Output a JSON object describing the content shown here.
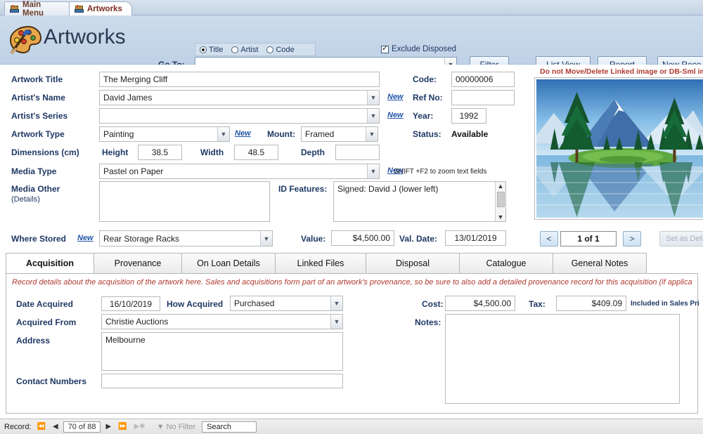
{
  "window": {
    "doc_tabs": [
      {
        "label": "Main Menu",
        "icon": "database-form-icon",
        "active": false
      },
      {
        "label": "Artworks",
        "icon": "database-form-icon",
        "active": true
      }
    ]
  },
  "header": {
    "title": "Artworks",
    "logo_icon": "artist-palette-icon",
    "search_modes": [
      {
        "label": "Title",
        "selected": true
      },
      {
        "label": "Artist",
        "selected": false
      },
      {
        "label": "Code",
        "selected": false
      }
    ],
    "goto_label": "Go To:",
    "goto_value": "",
    "exclude_disposed": {
      "label": "Exclude Disposed",
      "checked": true
    },
    "buttons": [
      {
        "label": "Filter",
        "accel": "F"
      },
      {
        "label": "List View",
        "accel": "L"
      },
      {
        "label": "Report",
        "accel": "R"
      },
      {
        "label": "New Reco",
        "accel": "N"
      }
    ]
  },
  "record": {
    "artwork_title": {
      "label": "Artwork Title",
      "value": "The Merging Cliff"
    },
    "artist_name": {
      "label": "Artist's Name",
      "value": "David James",
      "new_link": "New"
    },
    "artist_series": {
      "label": "Artist's Series",
      "value": "",
      "new_link": "New"
    },
    "artwork_type": {
      "label": "Artwork Type",
      "value": "Painting",
      "new_link": "New"
    },
    "mount": {
      "label": "Mount:",
      "value": "Framed"
    },
    "dimensions": {
      "label": "Dimensions (cm)",
      "height_label": "Height",
      "height": "38.5",
      "width_label": "Width",
      "width": "48.5",
      "depth_label": "Depth",
      "depth": ""
    },
    "media_type": {
      "label": "Media Type",
      "value": "Pastel on Paper",
      "new_link": "New"
    },
    "media_other": {
      "label": "Media Other",
      "sublabel": "(Details)",
      "value": ""
    },
    "id_features": {
      "label": "ID Features:",
      "value": "Signed: David J  (lower left)"
    },
    "where_stored": {
      "label": "Where Stored",
      "value": "Rear Storage Racks",
      "new_link": "New"
    },
    "value_field": {
      "label": "Value:",
      "value": "$4,500.00"
    },
    "val_date": {
      "label": "Val. Date:",
      "value": "13/01/2019"
    },
    "code": {
      "label": "Code:",
      "value": "00000006"
    },
    "ref_no": {
      "label": "Ref No:",
      "value": ""
    },
    "year": {
      "label": "Year:",
      "value": "1992"
    },
    "status": {
      "label": "Status:",
      "value": "Available"
    },
    "shift_f2_hint": "SHIFT +F2 to zoom text fields"
  },
  "image_panel": {
    "warning": "Do not Move/Delete Linked image or DB-Sml image co",
    "prev_label": "<",
    "next_label": ">",
    "counter": "1 of 1",
    "set_default_label": "Set as Defa"
  },
  "tabs": {
    "items": [
      {
        "label": "Acquisition",
        "active": true
      },
      {
        "label": "Provenance",
        "active": false
      },
      {
        "label": "On Loan Details",
        "active": false
      },
      {
        "label": "Linked Files",
        "active": false
      },
      {
        "label": "Disposal",
        "active": false
      },
      {
        "label": "Catalogue",
        "active": false
      },
      {
        "label": "General Notes",
        "active": false
      }
    ],
    "hint": "Record details about the acquisition of the artwork here.  Sales and acquisitions form part of an artwork's provenance, so be sure to also add a detailed provenance record for this acquisition (if applica"
  },
  "acquisition": {
    "date_acquired": {
      "label": "Date Acquired",
      "value": "16/10/2019"
    },
    "how_acquired": {
      "label": "How Acquired",
      "value": "Purchased"
    },
    "acquired_from": {
      "label": "Acquired From",
      "value": "Christie Auctions"
    },
    "address": {
      "label": "Address",
      "value": "Melbourne"
    },
    "contact_numbers": {
      "label": "Contact Numbers",
      "value": ""
    },
    "cost": {
      "label": "Cost:",
      "value": "$4,500.00"
    },
    "tax": {
      "label": "Tax:",
      "value": "$409.09"
    },
    "tax_note": "Included in Sales Pri",
    "notes": {
      "label": "Notes:",
      "value": ""
    }
  },
  "statusbar": {
    "record_label": "Record:",
    "position": "70 of 88",
    "filter_label": "No Filter",
    "search_placeholder": "Search",
    "search_value": "Search"
  }
}
